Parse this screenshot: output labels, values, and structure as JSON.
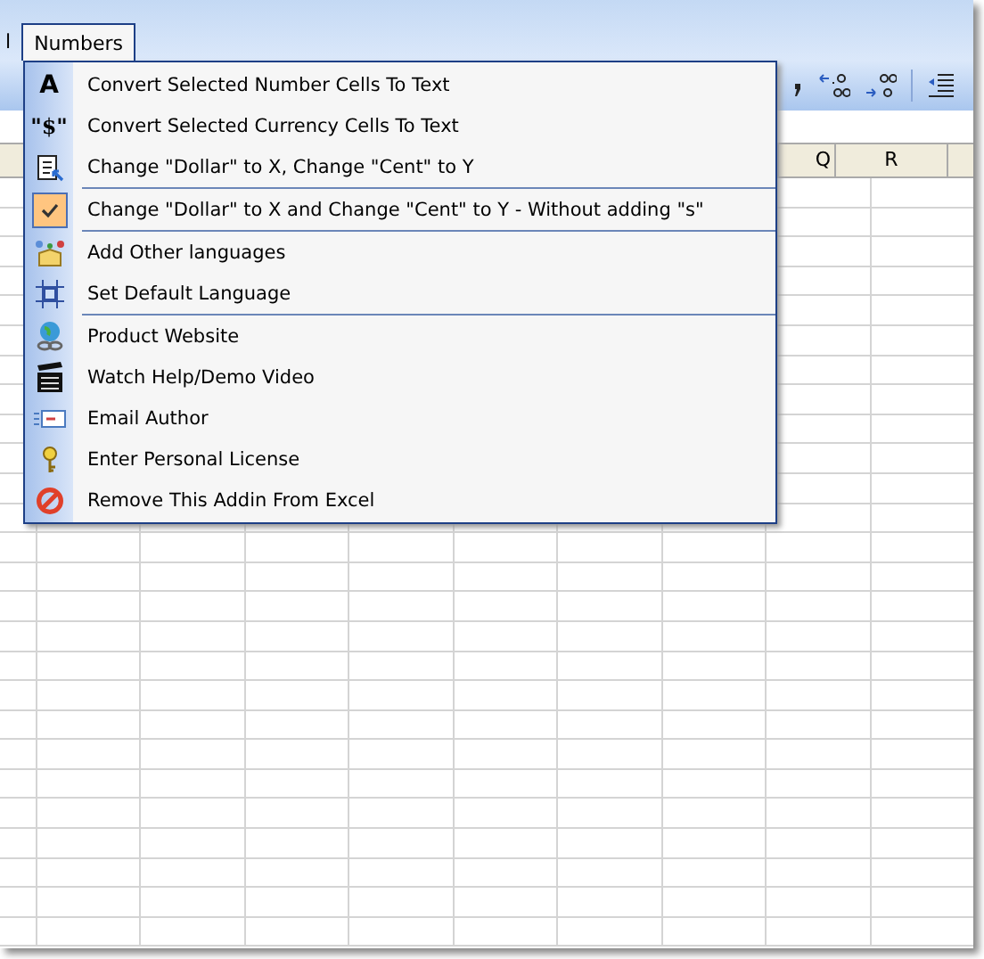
{
  "menubar": [
    {
      "label": "l",
      "selected": false
    },
    {
      "label": "Numbers",
      "selected": true
    }
  ],
  "columns": [
    "Q",
    "R"
  ],
  "menu": [
    {
      "label": "Convert Selected Number Cells To Text",
      "glyph": "A",
      "checked": false,
      "separator_before": false
    },
    {
      "label": "Convert Selected Currency Cells To Text",
      "glyph": "\"$\"",
      "checked": false,
      "separator_before": false
    },
    {
      "label": "Change \"Dollar\" to X, Change \"Cent\" to Y",
      "checked": false,
      "separator_before": false
    },
    {
      "label": "Change \"Dollar\" to X and Change \"Cent\" to Y - Without adding \"s\"",
      "checked": true,
      "separator_before": true
    },
    {
      "label": "Add Other languages",
      "checked": false,
      "separator_before": true
    },
    {
      "label": "Set Default Language",
      "checked": false,
      "separator_before": false
    },
    {
      "label": "Product Website",
      "checked": false,
      "separator_before": true
    },
    {
      "label": "Watch Help/Demo Video",
      "checked": false,
      "separator_before": false
    },
    {
      "label": "Email Author",
      "checked": false,
      "separator_before": false
    },
    {
      "label": "Enter Personal License",
      "checked": false,
      "separator_before": false
    },
    {
      "label": "Remove This Addin From Excel",
      "checked": false,
      "separator_before": false
    }
  ]
}
